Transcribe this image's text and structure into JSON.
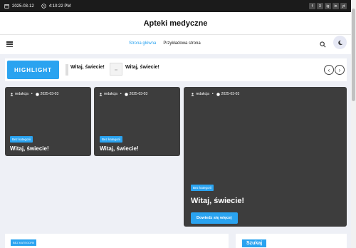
{
  "topbar": {
    "date": "2025-03-12",
    "time": "4:10:22 PM",
    "socials": [
      "f",
      "X",
      "ig",
      "in",
      "yt"
    ]
  },
  "site": {
    "title": "Apteki medyczne"
  },
  "nav": {
    "links": [
      {
        "label": "Strona główna",
        "active": true
      },
      {
        "label": "Przykładowa strona",
        "active": false
      }
    ]
  },
  "ticker": {
    "highlight": "HIGHLIGHT",
    "items": [
      "Witaj, świecie!",
      "Witaj, świecie!"
    ]
  },
  "cards": [
    {
      "author": "redakcja",
      "date": "2025-03-03",
      "category": "Bez kategorii",
      "title": "Witaj, świecie!"
    },
    {
      "author": "redakcja",
      "date": "2025-03-03",
      "category": "Bez kategorii",
      "title": "Witaj, świecie!"
    },
    {
      "author": "redakcja",
      "date": "2025-03-03",
      "category": "Bez kategorii",
      "title": "Witaj, świecie!",
      "button": "Dowiedz się więcej"
    }
  ],
  "bottom": {
    "badge": "BEZ KATEGORII",
    "search_title": "Szukaj"
  },
  "colors": {
    "accent": "#2aa3f0",
    "dark": "#3d3d3d",
    "topbar": "#1b1b1b"
  }
}
